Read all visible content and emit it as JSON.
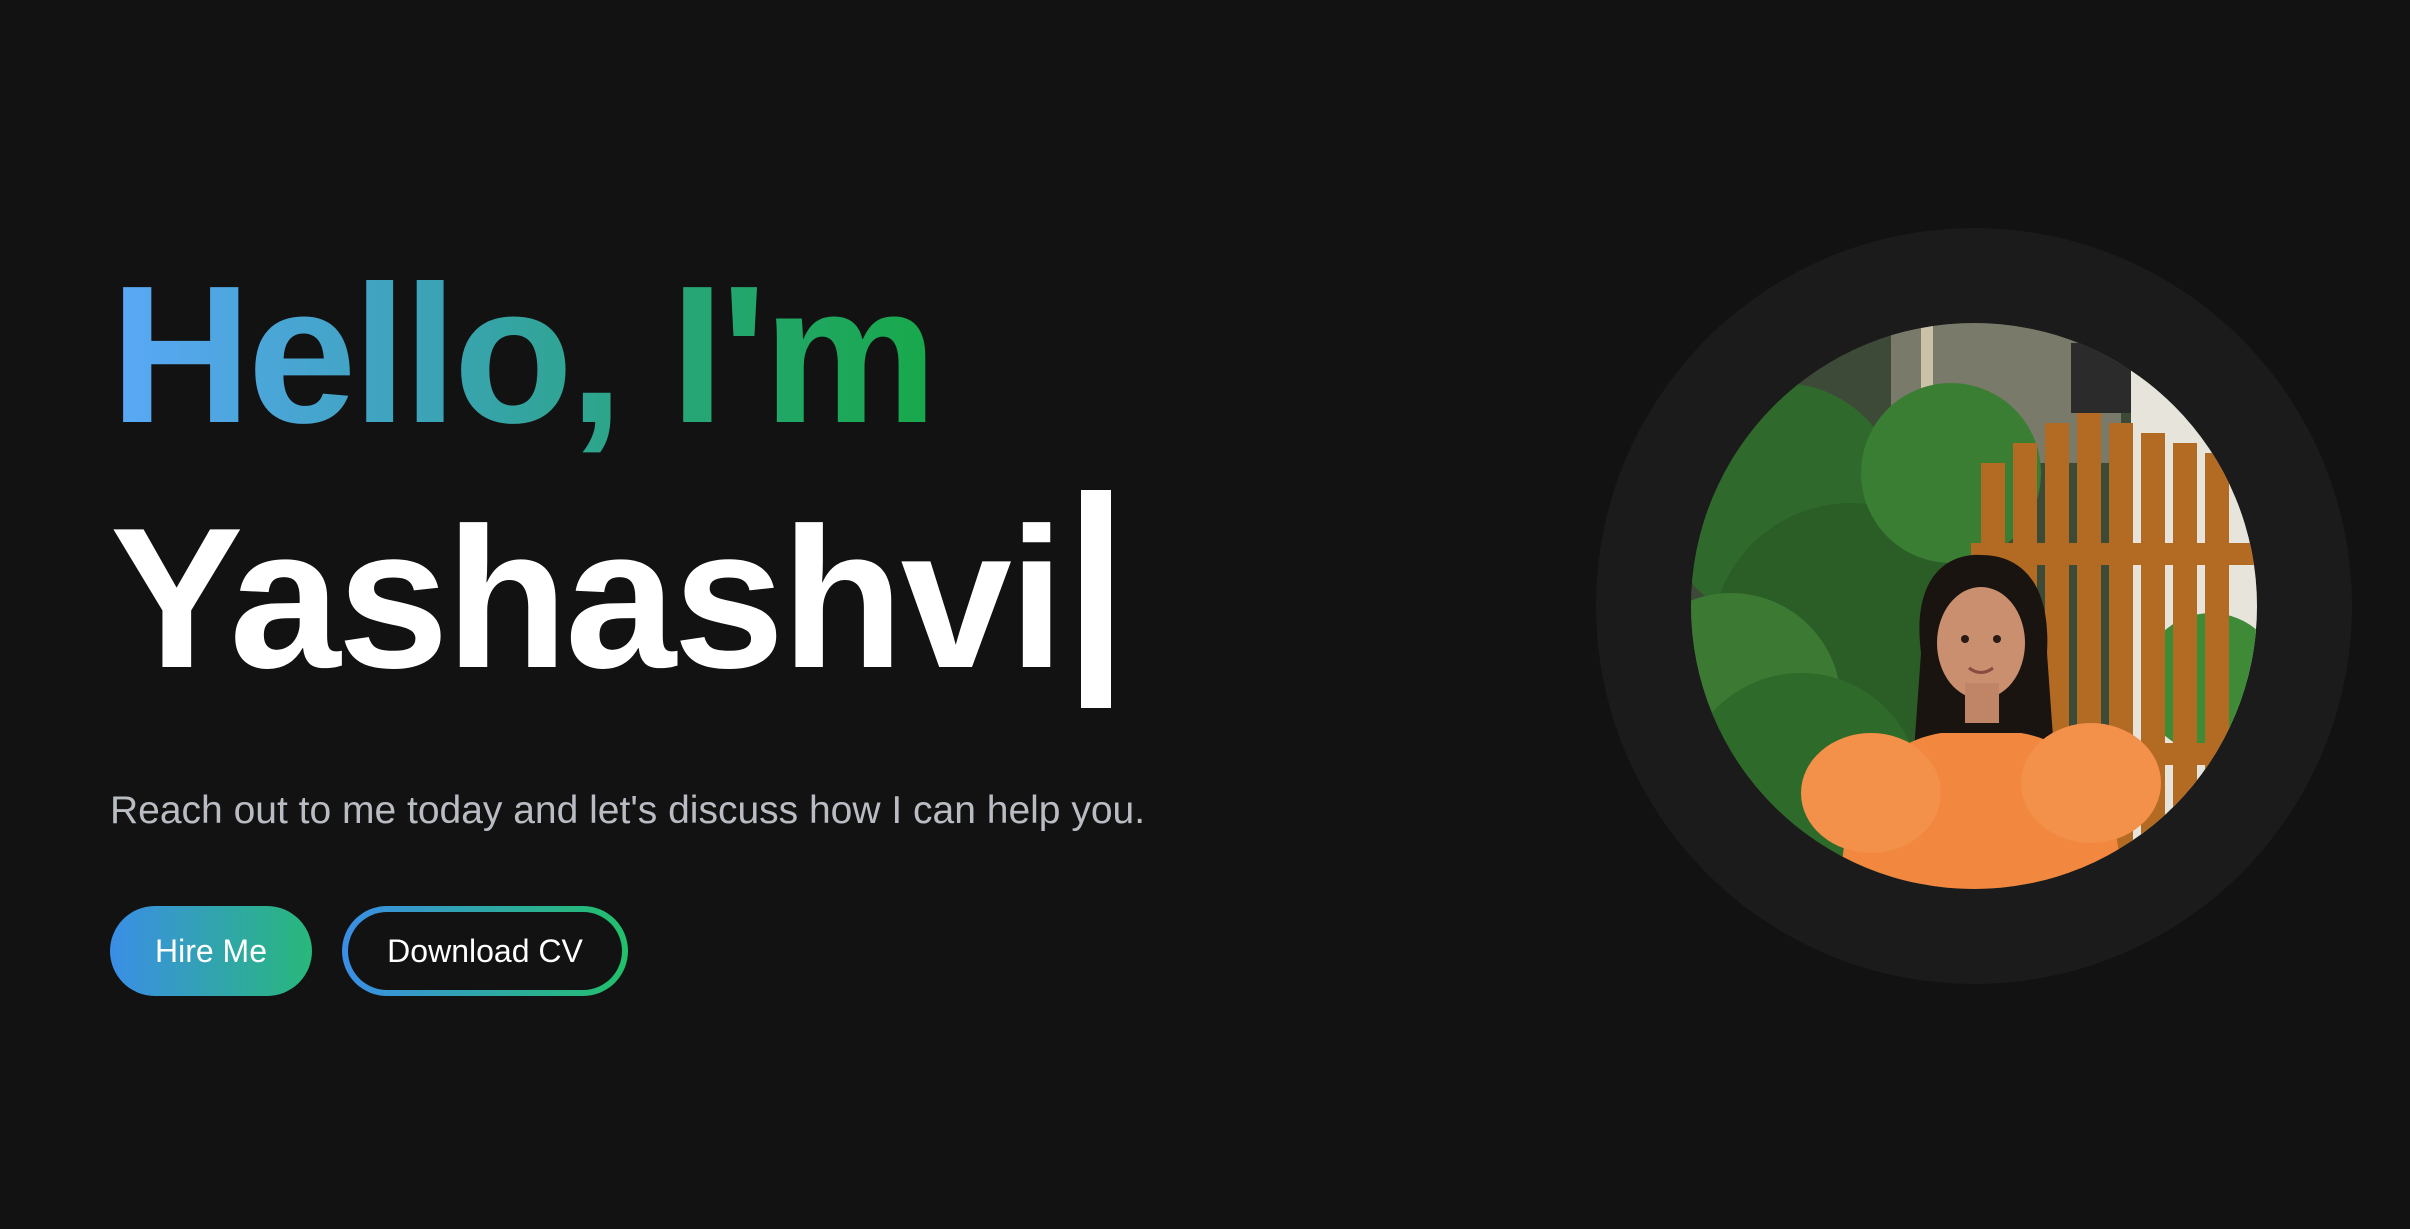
{
  "hero": {
    "greeting": "Hello, I'm",
    "name": "Yashashvi",
    "tagline": "Reach out to me today and let's discuss how I can help you."
  },
  "buttons": {
    "hire_me": "Hire Me",
    "download_cv": "Download CV"
  },
  "colors": {
    "background": "#121212",
    "gradient_start": "#3b8ee6",
    "gradient_end": "#22c06a"
  },
  "icons": {
    "avatar": "profile-photo"
  }
}
